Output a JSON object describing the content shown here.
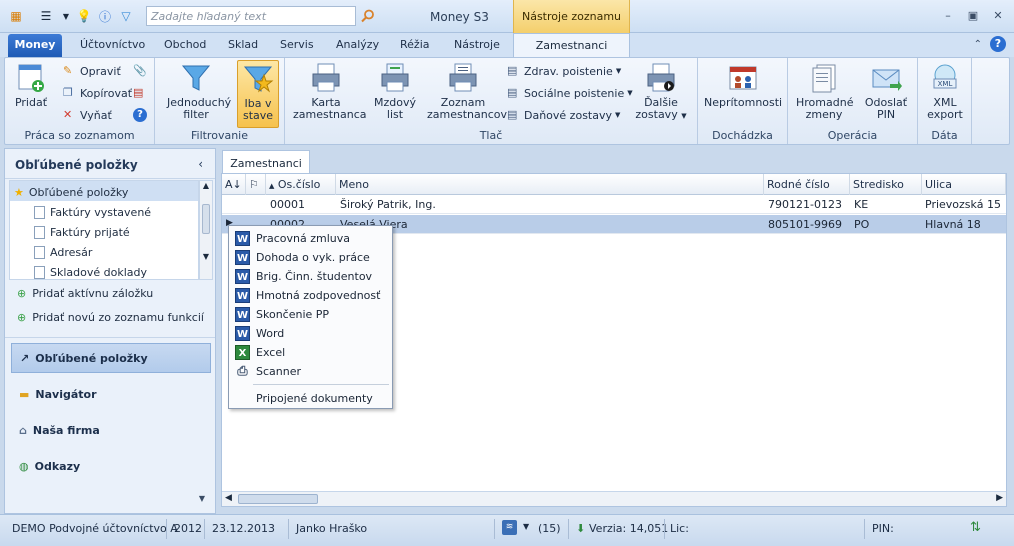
{
  "titlebar": {
    "search_placeholder": "Zadajte hľadaný text",
    "app_title": "Money S3",
    "tools_tab": "Nástroje zoznamu"
  },
  "tabs": {
    "money": "Money",
    "items": [
      "Účtovníctvo",
      "Obchod",
      "Sklad",
      "Servis",
      "Analýzy",
      "Réžia",
      "Nástroje"
    ],
    "active": "Zamestnanci"
  },
  "ribbon": {
    "group1": {
      "label": "Práca so zoznamom",
      "add": "Pridať",
      "edit": "Opraviť",
      "copy": "Kopírovať",
      "remove": "Vyňať"
    },
    "group2": {
      "label": "Filtrovanie",
      "simple_filter_1": "Jednoduchý",
      "simple_filter_2": "filter",
      "only_selected_1": "Iba v",
      "only_selected_2": "stave"
    },
    "group3": {
      "label": "Tlač",
      "card_1": "Karta",
      "card_2": "zamestnanca",
      "payroll_1": "Mzdový",
      "payroll_2": "list",
      "list_1": "Zoznam",
      "list_2": "zamestnancov",
      "health": "Zdrav. poistenie",
      "social": "Sociálne poistenie",
      "tax": "Daňové zostavy",
      "more_1": "Ďalšie",
      "more_2": "zostavy"
    },
    "group4": {
      "label": "Dochádzka",
      "absence": "Neprítomnosti"
    },
    "group5": {
      "label": "Operácia",
      "bulk_1": "Hromadné",
      "bulk_2": "zmeny",
      "send_1": "Odoslať",
      "send_2": "PIN"
    },
    "group6": {
      "label": "Dáta",
      "xml_1": "XML",
      "xml_2": "export"
    }
  },
  "leftpanel": {
    "header": "Obľúbené položky",
    "tree": [
      "Obľúbené položky",
      "Faktúry vystavené",
      "Faktúry prijaté",
      "Adresár",
      "Skladové doklady"
    ],
    "add_active_tab": "Pridať aktívnu záložku",
    "add_new": "Pridať novú zo zoznamu funkcií",
    "nav": [
      "Obľúbené položky",
      "Navigátor",
      "Naša firma",
      "Odkazy"
    ]
  },
  "grid": {
    "tab": "Zamestnanci",
    "columns": [
      "Os.číslo",
      "Meno",
      "Rodné číslo",
      "Stredisko",
      "Ulica"
    ],
    "rows": [
      [
        "00001",
        "Široký Patrik, Ing.",
        "790121-0123",
        "KE",
        "Prievozská 15"
      ],
      [
        "00002",
        "Veselá Viera",
        "805101-9969",
        "PO",
        "Hlavná 18"
      ]
    ]
  },
  "context_menu": {
    "items": [
      "Pracovná zmluva",
      "Dohoda o vyk. práce",
      "Brig. Činn. študentov",
      "Hmotná zodpovednosť",
      "Skončenie PP",
      "Word",
      "Excel",
      "Scanner"
    ],
    "attached": "Pripojené dokumenty"
  },
  "status": {
    "company": "DEMO Podvojné účtovníctvo A",
    "year": "2012",
    "date": "23.12.2013",
    "user": "Janko Hraško",
    "rss_count": "(15)",
    "version": "Verzia: 14,051",
    "lic": "Lic:",
    "pin": "PIN:"
  },
  "colors": {
    "accent": "#1f5bb5",
    "tools_tab": "#f4cf6c",
    "selection": "#b9cde8"
  }
}
